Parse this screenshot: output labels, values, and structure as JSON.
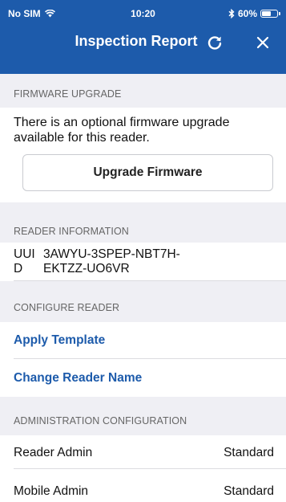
{
  "status_bar": {
    "carrier": "No SIM",
    "time": "10:20",
    "battery": "60%",
    "battery_fraction": 0.6
  },
  "nav": {
    "title": "Inspection Report"
  },
  "firmware": {
    "header": "FIRMWARE UPGRADE",
    "message": "There is an optional firmware upgrade available for this reader.",
    "button_label": "Upgrade Firmware"
  },
  "reader_info": {
    "header": "READER INFORMATION",
    "uuid_label_line1": "UUI",
    "uuid_label_line2": "D",
    "uuid_value_line1": "3AWYU-3SPEP-NBT7H-",
    "uuid_value_line2": "EKTZZ-UO6VR"
  },
  "configure": {
    "header": "CONFIGURE READER",
    "apply_template": "Apply Template",
    "change_name": "Change Reader Name"
  },
  "admin": {
    "header": "ADMINISTRATION CONFIGURATION",
    "rows": [
      {
        "label": "Reader Admin",
        "value": "Standard"
      },
      {
        "label": "Mobile Admin",
        "value": "Standard"
      }
    ]
  },
  "colors": {
    "brand": "#1d5bab",
    "background": "#efeff4"
  }
}
